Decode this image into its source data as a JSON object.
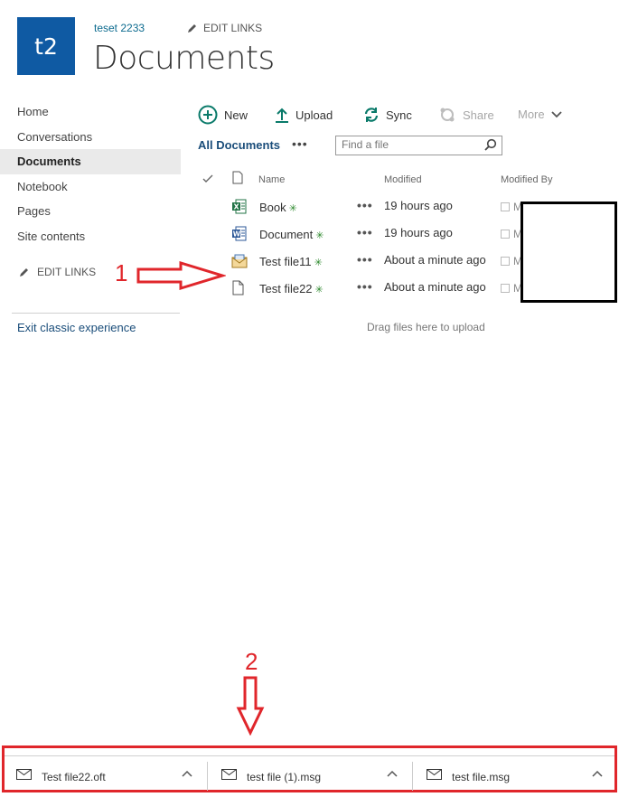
{
  "header": {
    "site_logo_text": "t2",
    "site_name": "teset 2233",
    "edit_links": "EDIT LINKS",
    "page_title": "Documents"
  },
  "leftnav": {
    "items": [
      {
        "label": "Home",
        "selected": false
      },
      {
        "label": "Conversations",
        "selected": false
      },
      {
        "label": "Documents",
        "selected": true
      },
      {
        "label": "Notebook",
        "selected": false
      },
      {
        "label": "Pages",
        "selected": false
      },
      {
        "label": "Site contents",
        "selected": false
      }
    ],
    "edit_links": "EDIT LINKS",
    "exit_classic": "Exit classic experience"
  },
  "commands": {
    "new": "New",
    "upload": "Upload",
    "sync": "Sync",
    "share": "Share",
    "more": "More"
  },
  "view": {
    "name": "All Documents",
    "more_dots": "•••",
    "search_placeholder": "Find a file"
  },
  "table": {
    "columns": {
      "name": "Name",
      "modified": "Modified",
      "modified_by": "Modified By"
    },
    "row_dots": "•••",
    "new_marker": "✳",
    "rows": [
      {
        "name": "Book",
        "icon": "excel-icon",
        "modified": "19 hours ago",
        "modified_by": "M"
      },
      {
        "name": "Document",
        "icon": "word-icon",
        "modified": "19 hours ago",
        "modified_by": "M"
      },
      {
        "name": "Test file11",
        "icon": "email-template-icon",
        "modified": "About a minute ago",
        "modified_by": "M"
      },
      {
        "name": "Test file22",
        "icon": "file-icon",
        "modified": "About a minute ago",
        "modified_by": "M"
      }
    ],
    "drag_hint": "Drag files here to upload"
  },
  "annotations": {
    "label_1": "1",
    "label_2": "2",
    "color": "#e0262b"
  },
  "downloads": [
    {
      "filename": "Test file22.oft"
    },
    {
      "filename": "test file (1).msg"
    },
    {
      "filename": "test file.msg"
    }
  ],
  "colors": {
    "brand": "#0f5aa3",
    "link": "#0d6b8f",
    "annotation_red": "#e0262b"
  }
}
